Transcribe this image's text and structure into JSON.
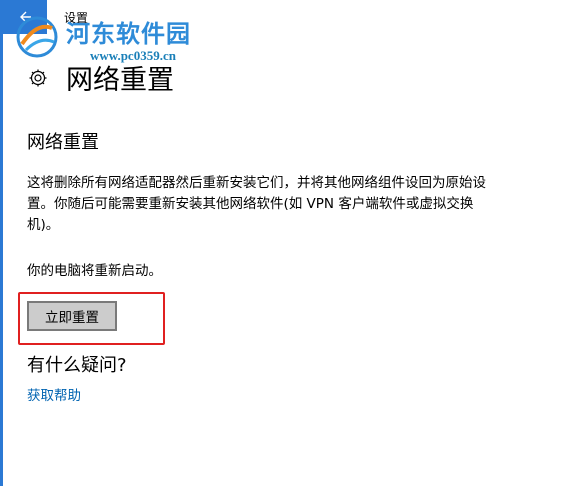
{
  "window": {
    "title": "设置"
  },
  "watermark": {
    "name": "河东软件园",
    "url": "www.pc0359.cn"
  },
  "header": {
    "title": "网络重置"
  },
  "section": {
    "title": "网络重置",
    "description": "这将删除所有网络适配器然后重新安装它们，并将其他网络组件设回为原始设置。你随后可能需要重新安装其他网络软件(如 VPN 客户端软件或虚拟交换机)。",
    "restart_note": "你的电脑将重新启动。",
    "reset_button_label": "立即重置"
  },
  "help": {
    "question": "有什么疑问?",
    "link_label": "获取帮助"
  },
  "colors": {
    "accent": "#2b79d4",
    "highlight": "#e02020",
    "link": "#0063b1"
  },
  "icons": {
    "back": "back-arrow-icon",
    "settings": "gear-icon"
  }
}
